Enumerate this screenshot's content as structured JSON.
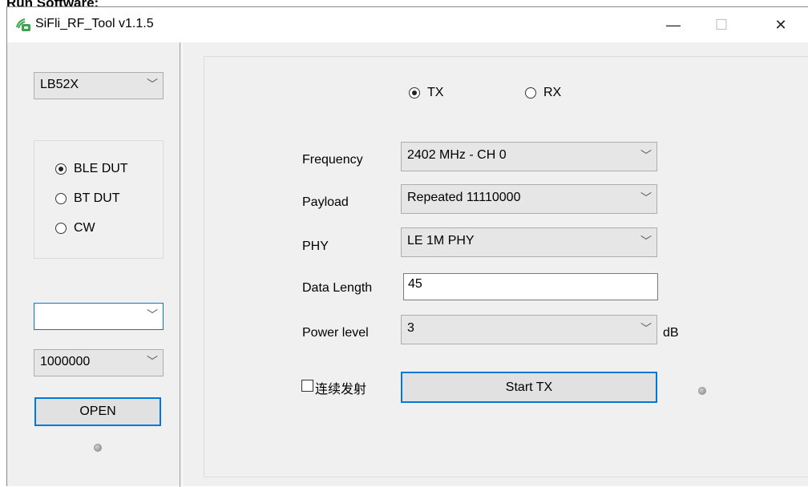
{
  "doc_heading": "Run Software:",
  "window": {
    "title": "SiFli_RF_Tool v1.1.5",
    "icon": "sifli-app-icon",
    "minimize": "—",
    "maximize": "☐",
    "close": "✕"
  },
  "left": {
    "chip_select": "LB52X",
    "modes": [
      {
        "label": "BLE DUT",
        "selected": true
      },
      {
        "label": "BT DUT",
        "selected": false
      },
      {
        "label": "CW",
        "selected": false
      }
    ],
    "port_select": "",
    "baud_select": "1000000",
    "open_button": "OPEN"
  },
  "main": {
    "tx_label": "TX",
    "tx_selected": true,
    "rx_label": "RX",
    "frequency": {
      "label": "Frequency",
      "value": "2402 MHz - CH 0"
    },
    "payload": {
      "label": "Payload",
      "value": "Repeated 11110000"
    },
    "phy": {
      "label": "PHY",
      "value": "LE 1M PHY"
    },
    "data_length": {
      "label": "Data Length",
      "value": "45"
    },
    "power_level": {
      "label": "Power level",
      "value": "3",
      "unit": "dB"
    },
    "continuous_label": "连续发射",
    "continuous_checked": false,
    "start_button": "Start TX"
  }
}
